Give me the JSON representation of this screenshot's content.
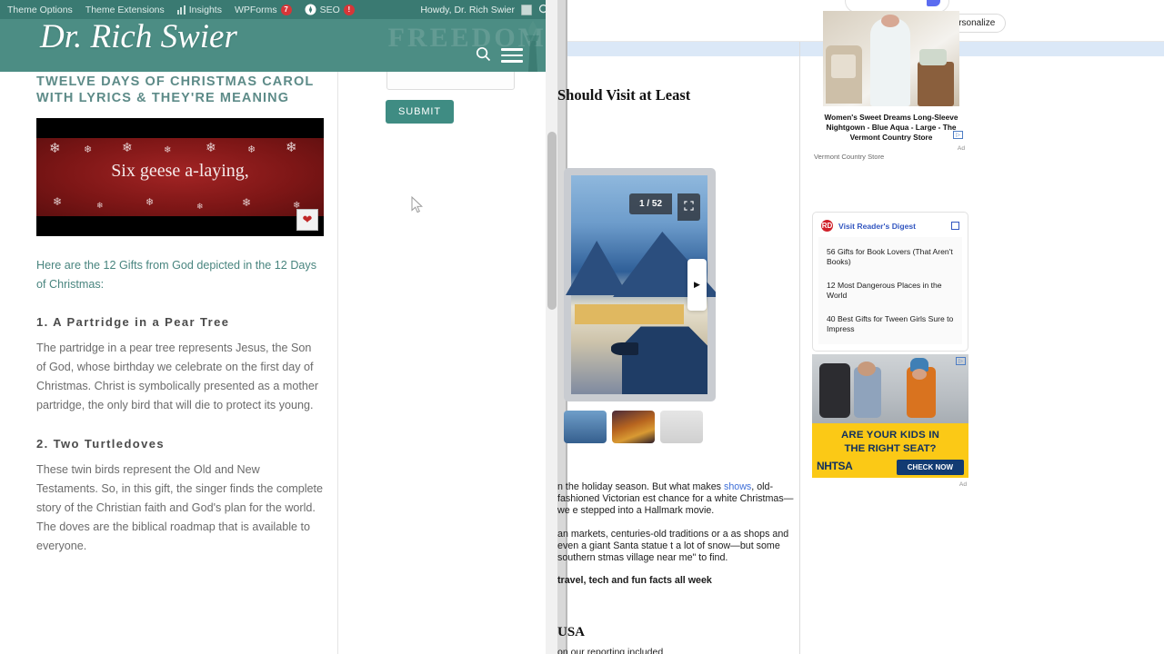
{
  "left_window": {
    "adminbar": {
      "items": [
        {
          "label": "Theme Options",
          "badge": null
        },
        {
          "label": "Theme Extensions",
          "badge": null
        },
        {
          "label": "Insights",
          "badge": null
        },
        {
          "label": "WPForms",
          "badge": "7"
        },
        {
          "label": "SEO",
          "badge": "!"
        }
      ],
      "howdy": "Howdy, Dr. Rich Swier",
      "search_icon": "search-icon",
      "avatar_icon": "avatar-icon"
    },
    "header": {
      "logo_text": "Dr. Rich Swier",
      "bg_text": "FREEDOM",
      "search_icon": "search-icon",
      "menu_icon": "hamburger-menu-icon"
    },
    "article": {
      "title": "TWELVE DAYS OF CHRISTMAS CAROL WITH LYRICS & THEY'RE MEANING",
      "video_caption": "Six geese a-laying,",
      "lede": "Here are the 12 Gifts from God depicted in the 12 Days of Christmas:",
      "sections": [
        {
          "heading": "1. A Partridge in a Pear Tree",
          "body": "The partridge in a pear tree represents Jesus, the Son of God, whose birthday we celebrate on the first day of Christmas. Christ is symbolically presented as a mother partridge, the only bird that will die to protect its young."
        },
        {
          "heading": "2. Two Turtledoves",
          "body": "These twin birds represent the Old and New Testaments. So, in this gift, the singer finds the complete story of the Christian faith and God's plan for the world. The doves are the biblical roadmap that is available to everyone."
        }
      ]
    },
    "form": {
      "submit_label": "SUBMIT",
      "input_value": ""
    }
  },
  "right_window": {
    "topbar": {
      "personalize_label": "Personalize",
      "personalize_icon": "star-icon"
    },
    "headline": "Should Visit at Least",
    "carousel": {
      "counter": "1 / 52",
      "fullscreen_icon": "fullscreen-icon",
      "next_icon": "chevron-right-icon"
    },
    "body_paragraphs": [
      {
        "runs": [
          {
            "text": "n the holiday season. But what makes ",
            "style": "plain"
          },
          {
            "text": "shows",
            "style": "link"
          },
          {
            "text": ", old-fashioned Victorian est chance for a white Christmas—we e stepped into a Hallmark movie.",
            "style": "plain"
          }
        ]
      },
      {
        "runs": [
          {
            "text": "an markets, centuries-old traditions or a as shops and even a giant Santa statue t a lot of snow—but some southern stmas village near me\" to find.",
            "style": "plain"
          }
        ]
      },
      {
        "runs": [
          {
            "text": "travel, tech and fun facts all week",
            "style": "bold"
          }
        ]
      }
    ],
    "subheading": "USA",
    "sub_paragraph": "on our reporting included",
    "ad_nightgown": {
      "title": "Women's Sweet Dreams Long-Sleeve Nightgown - Blue Aqua - Large - The Vermont Country Store",
      "source": "Vermont Country Store",
      "ad_label": "Ad",
      "adchoices_icon": "adchoices-icon"
    },
    "rd_widget": {
      "title": "Visit Reader's Digest",
      "logo_icon": "readers-digest-logo-icon",
      "external_link_icon": "external-link-icon",
      "links": [
        "56 Gifts for Book Lovers (That Aren't Books)",
        "12 Most Dangerous Places in the World",
        "40 Best Gifts for Tween Girls Sure to Impress"
      ]
    },
    "ad_nhtsa": {
      "line1": "ARE YOUR KIDS IN",
      "line2": "THE RIGHT SEAT?",
      "brand": "NHTSA",
      "cta": "CHECK NOW",
      "ad_label": "Ad",
      "adchoices_icon": "adchoices-icon"
    }
  },
  "colors": {
    "wp_teal": "#4c8d84",
    "adminbar_teal": "#3a7a72",
    "link_blue": "#3f6fd8",
    "ad_yellow": "#fbc916",
    "ad_navy": "#10305e",
    "badge_red": "#d63638"
  }
}
